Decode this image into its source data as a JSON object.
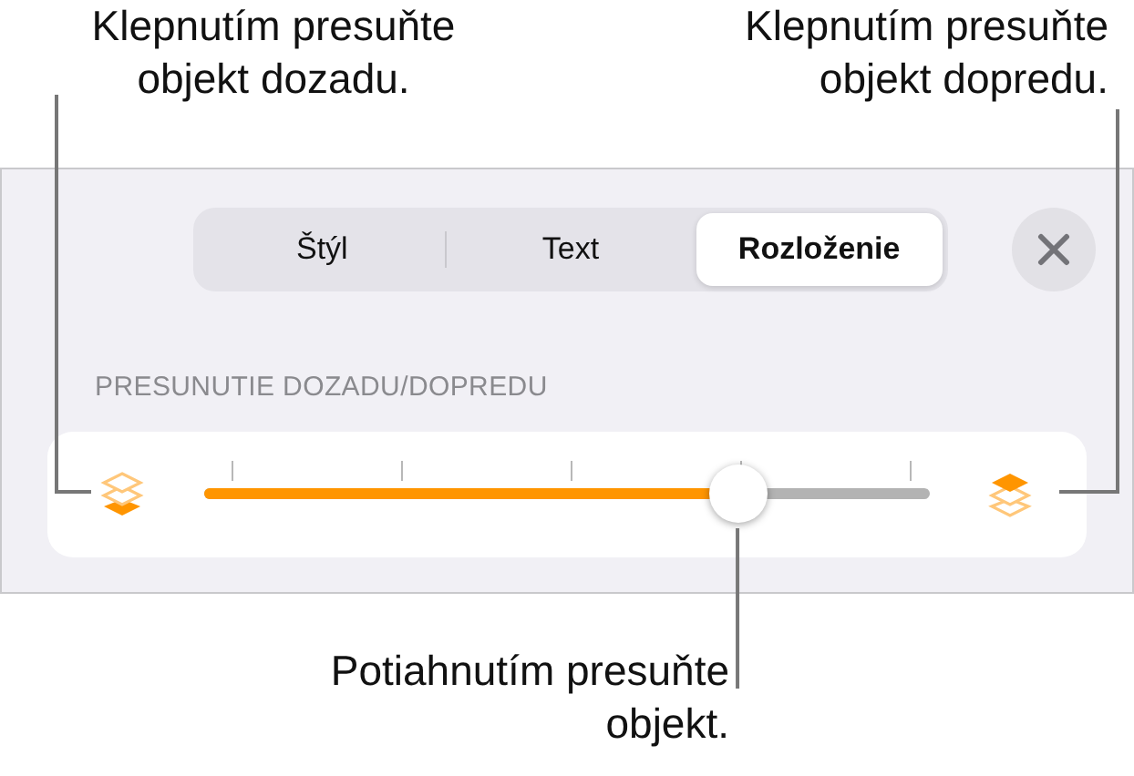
{
  "callouts": [
    {
      "text": "Klepnutím presuňte objekt dozadu."
    },
    {
      "text": "Klepnutím presuňte objekt dopredu."
    },
    {
      "text": "Potiahnutím presuňte objekt."
    }
  ],
  "tabs": [
    {
      "label": "Štýl",
      "selected": false
    },
    {
      "label": "Text",
      "selected": false
    },
    {
      "label": "Rozloženie",
      "selected": true
    }
  ],
  "section_label": "PRESUNUTIE DOZADU/DOPREDU",
  "slider": {
    "level": 0.735
  }
}
